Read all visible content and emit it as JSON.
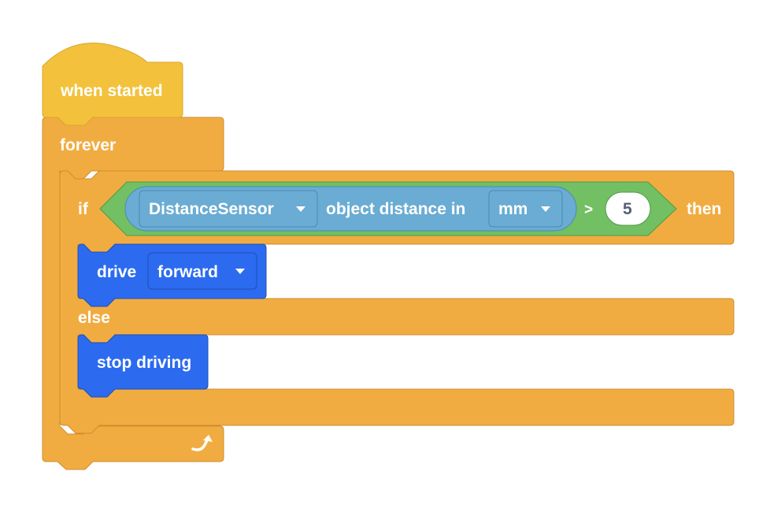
{
  "workspace": {
    "colors": {
      "event_block": "#f3c13c",
      "event_border": "#d9a62e",
      "control_block": "#f1ac41",
      "control_border": "#cf8c2e",
      "operator_block": "#72bf64",
      "operator_border": "#4f9b42",
      "sensing_block": "#6aacd3",
      "sensing_border": "#4b8ab5",
      "drivetrain_block": "#2c6bef",
      "drivetrain_border": "#1d4fb8",
      "number_text": "#575e75"
    },
    "hat_block": {
      "label": "when started"
    },
    "forever_block": {
      "label": "forever",
      "loop_icon": "loop-arrow-icon"
    },
    "if_else_block": {
      "if_label": "if",
      "then_label": "then",
      "else_label": "else",
      "condition": {
        "operator": ">",
        "sensor_block": {
          "sensor_dropdown": {
            "value": "DistanceSensor"
          },
          "text": "object distance in",
          "unit_dropdown": {
            "value": "mm"
          }
        },
        "compare_value": "5"
      },
      "then_branch": {
        "drive_block": {
          "label": "drive",
          "direction_dropdown": {
            "value": "forward"
          }
        }
      },
      "else_branch": {
        "stop_block": {
          "label": "stop driving"
        }
      }
    }
  }
}
